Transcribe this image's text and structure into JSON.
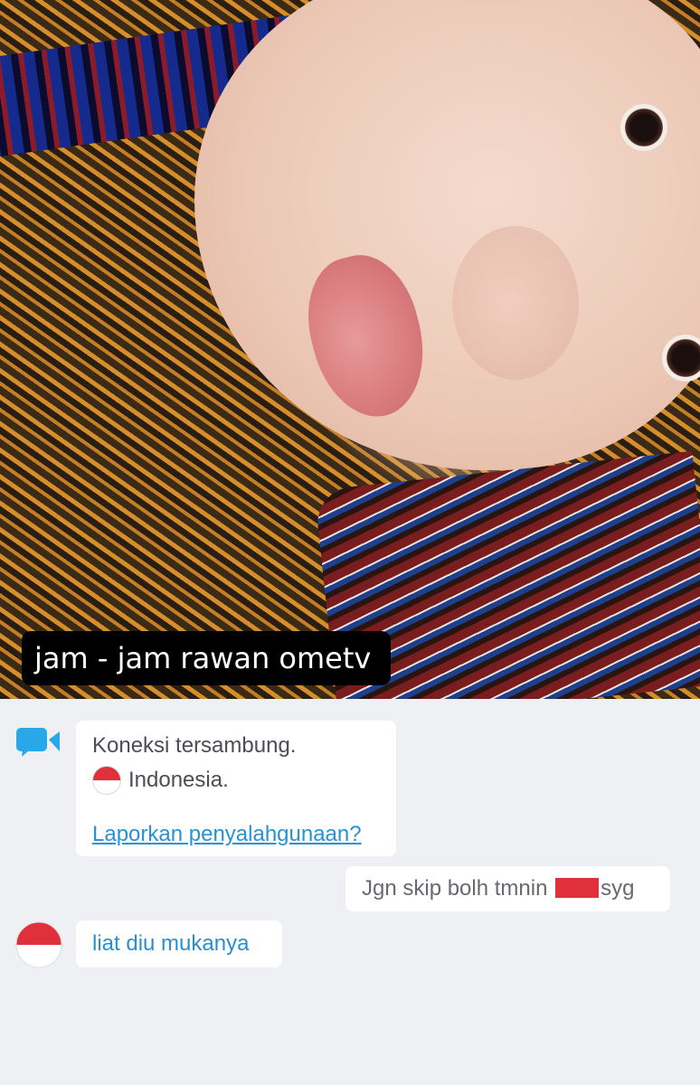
{
  "video": {
    "caption": "jam - jam rawan ometv"
  },
  "chat": {
    "system": {
      "status": "Koneksi tersambung.",
      "country": "Indonesia.",
      "report_link": "Laporkan penyalahgunaan?",
      "icon": "video-camera-icon"
    },
    "outgoing": {
      "text_before": "Jgn skip bolh tmnin",
      "text_after": "syg"
    },
    "incoming": {
      "avatar": "indonesia-flag-icon",
      "text": "liat diu mukanya"
    }
  },
  "colors": {
    "link": "#2693d6",
    "incoming_text": "#2a8fd0",
    "flag_red": "#e0303c",
    "background": "#eef0f3"
  }
}
